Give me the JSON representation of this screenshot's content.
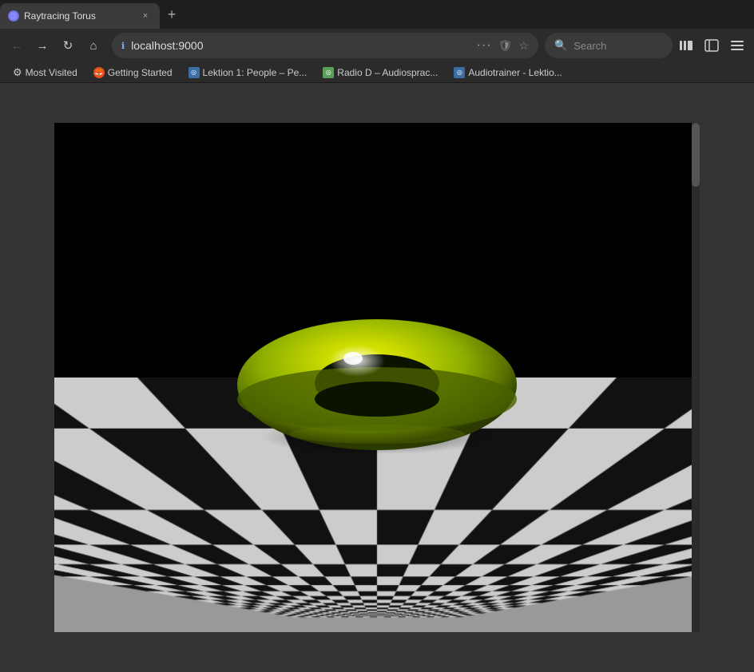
{
  "titlebar": {
    "tab": {
      "favicon_color": "#8866cc",
      "title": "Raytracing Torus",
      "close_label": "×"
    },
    "new_tab_label": "+"
  },
  "navbar": {
    "back_label": "←",
    "forward_label": "→",
    "reload_label": "↻",
    "home_label": "⌂",
    "address": "localhost:9000",
    "dots_label": "···",
    "search_placeholder": "Search",
    "bookmarks_label": "≡",
    "sidebar_label": "⊡",
    "menu_label": "≡"
  },
  "bookmarks": [
    {
      "label": "Most Visited",
      "icon": "gear",
      "favicon_bg": "transparent"
    },
    {
      "label": "Getting Started",
      "icon": "firefox",
      "favicon_bg": "#e84e1c"
    },
    {
      "label": "Lektion 1: People – Pe...",
      "icon": "custom",
      "favicon_bg": "#3a6ea5"
    },
    {
      "label": "Radio D – Audiosprac...",
      "icon": "custom",
      "favicon_bg": "#5aa05a"
    },
    {
      "label": "Audiotrainer - Lektio...",
      "icon": "custom",
      "favicon_bg": "#3a6ea5"
    }
  ],
  "canvas": {
    "bg_color": "#000000",
    "torus_color_main": "#8db000",
    "torus_color_highlight": "#d4e800",
    "torus_color_shadow": "#4a5e00"
  }
}
